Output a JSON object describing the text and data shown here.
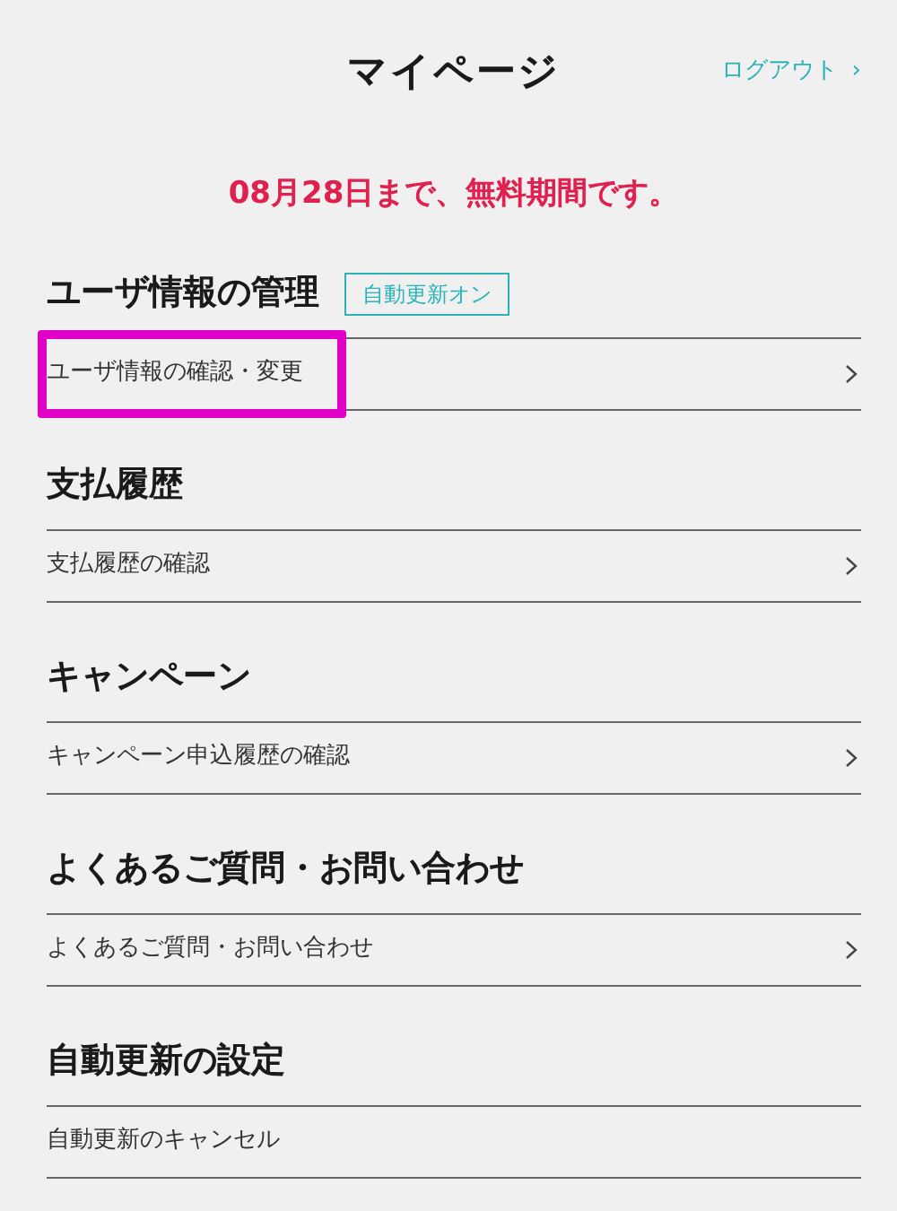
{
  "header": {
    "title": "マイページ",
    "logout_link": "ログアウト",
    "logout_arrow": "›"
  },
  "notice": "08月28日まで、無料期間です。",
  "sections": [
    {
      "heading": "ユーザ情報の管理",
      "badge": "自動更新オン",
      "rows": [
        {
          "label": "ユーザ情報の確認・変更",
          "chevron": true,
          "highlighted": true
        }
      ]
    },
    {
      "heading": "支払履歴",
      "rows": [
        {
          "label": "支払履歴の確認",
          "chevron": true,
          "highlighted": false
        }
      ]
    },
    {
      "heading": "キャンペーン",
      "rows": [
        {
          "label": "キャンペーン申込履歴の確認",
          "chevron": true,
          "highlighted": false
        }
      ]
    },
    {
      "heading": "よくあるご質問・お問い合わせ",
      "rows": [
        {
          "label": "よくあるご質問・お問い合わせ",
          "chevron": true,
          "highlighted": false
        }
      ]
    },
    {
      "heading": "自動更新の設定",
      "rows": [
        {
          "label": "自動更新のキャンセル",
          "chevron": false,
          "highlighted": false
        }
      ]
    }
  ]
}
